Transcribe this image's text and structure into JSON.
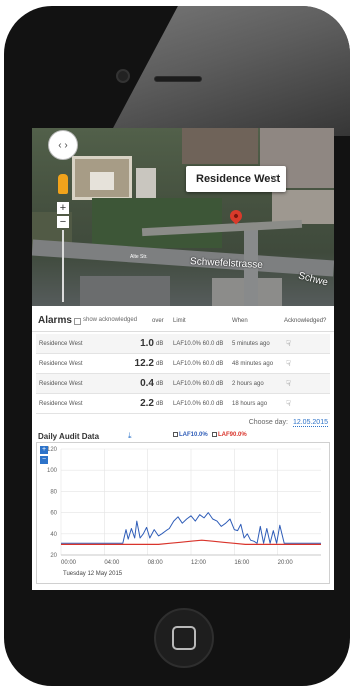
{
  "map": {
    "nav_glyph": "‹ ›",
    "zoom_in": "+",
    "zoom_out": "−",
    "info_title": "Residence West",
    "info_close": "×",
    "street_1": "Schwefelstrasse",
    "street_2": "Schwe",
    "road_label": "Alte Str."
  },
  "alarms": {
    "title": "Alarms",
    "show_ack_label": "show acknowledged",
    "headers": {
      "over": "over",
      "limit": "Limit",
      "when": "When",
      "ack": "Acknowledged?"
    },
    "rows": [
      {
        "location": "Residence West",
        "over": "1.0",
        "unit": "dB",
        "limit": "LAF10.0% 60.0 dB",
        "when": "5 minutes ago",
        "ack_icon": "thumbs-down-icon"
      },
      {
        "location": "Residence West",
        "over": "12.2",
        "unit": "dB",
        "limit": "LAF10.0% 60.0 dB",
        "when": "48 minutes ago",
        "ack_icon": "thumbs-down-icon"
      },
      {
        "location": "Residence West",
        "over": "0.4",
        "unit": "dB",
        "limit": "LAF10.0% 60.0 dB",
        "when": "2 hours ago",
        "ack_icon": "thumbs-down-icon"
      },
      {
        "location": "Residence West",
        "over": "2.2",
        "unit": "dB",
        "limit": "LAF10.0% 60.0 dB",
        "when": "18 hours ago",
        "ack_icon": "thumbs-down-icon"
      }
    ],
    "ack_glyph": "☟"
  },
  "day_picker": {
    "label": "Choose day:",
    "date": "12.05.2015"
  },
  "chart": {
    "title": "Daily Audit Data",
    "download_glyph": "⤓",
    "zoom_in": "+",
    "zoom_out": "−",
    "date_label": "Tuesday 12 May 2015"
  },
  "colors": {
    "accent": "#2d73c9",
    "laf10": "#2f5db8",
    "laf90": "#d9342b"
  },
  "chart_data": {
    "type": "line",
    "x_ticks": [
      "00:00",
      "04:00",
      "08:00",
      "12:00",
      "16:00",
      "20:00"
    ],
    "y_ticks": [
      20,
      40,
      60,
      80,
      100,
      120
    ],
    "ylim": [
      20,
      120
    ],
    "xlim": [
      0,
      24
    ],
    "legend_position": "top",
    "grid": true,
    "series": [
      {
        "name": "LAF10.0%",
        "color": "#2f5db8",
        "x": [
          0,
          5.7,
          6.0,
          6.2,
          6.5,
          6.8,
          7.0,
          7.3,
          7.6,
          7.9,
          8.2,
          8.6,
          9.0,
          9.3,
          9.7,
          10.0,
          10.4,
          10.8,
          11.2,
          11.6,
          12.0,
          12.4,
          12.8,
          13.2,
          13.6,
          14.0,
          14.4,
          14.8,
          15.2,
          15.6,
          16.0,
          16.3,
          16.6,
          16.9,
          17.2,
          17.5,
          17.8,
          18.1,
          18.4,
          18.7,
          19.0,
          19.3,
          19.6,
          19.9,
          20.2,
          20.6,
          21.0,
          24
        ],
        "y": [
          31,
          31,
          44,
          35,
          45,
          36,
          52,
          36,
          40,
          46,
          36,
          44,
          38,
          40,
          43,
          45,
          52,
          56,
          50,
          54,
          57,
          52,
          58,
          55,
          60,
          54,
          52,
          47,
          50,
          54,
          44,
          43,
          49,
          36,
          40,
          34,
          33,
          31,
          47,
          31,
          45,
          31,
          43,
          31,
          48,
          31,
          31,
          31
        ]
      },
      {
        "name": "LAF90.0%",
        "color": "#d9342b",
        "x": [
          0,
          6.0,
          7.0,
          8.0,
          9.0,
          10.0,
          11.0,
          12.0,
          13.0,
          14.0,
          15.0,
          16.0,
          17.0,
          18.0,
          20.0,
          24
        ],
        "y": [
          30,
          30,
          30,
          30,
          30,
          31,
          32,
          33,
          34,
          33,
          32,
          31,
          30,
          30,
          30,
          30
        ]
      }
    ]
  }
}
